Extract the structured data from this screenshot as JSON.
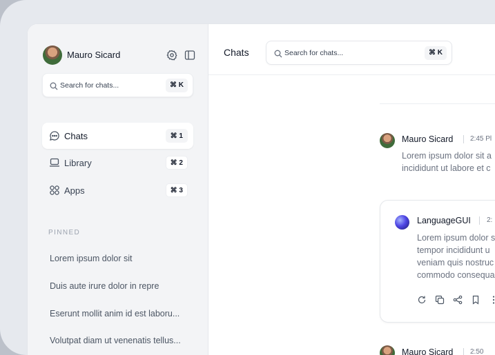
{
  "user": {
    "name": "Mauro Sicard"
  },
  "sidebar": {
    "search": {
      "placeholder": "Search for chats...",
      "shortcut": "⌘ K"
    },
    "nav": [
      {
        "label": "Chats",
        "shortcut": "⌘ 1",
        "icon": "chat-bubble-icon",
        "active": true
      },
      {
        "label": "Library",
        "shortcut": "⌘ 2",
        "icon": "laptop-icon",
        "active": false
      },
      {
        "label": "Apps",
        "shortcut": "⌘ 3",
        "icon": "apps-grid-icon",
        "active": false
      }
    ],
    "pinned_heading": "PINNED",
    "pinned": [
      "Lorem ipsum dolor sit",
      "Duis aute irure dolor in repre",
      "Eserunt mollit anim id est laboru...",
      "Volutpat diam ut venenatis tellus..."
    ]
  },
  "header": {
    "title": "Chats",
    "search": {
      "placeholder": "Search for chats...",
      "shortcut": "⌘ K"
    }
  },
  "messages": [
    {
      "author": "Mauro Sicard",
      "time": "2:45 Pl",
      "lines": [
        "Lorem ipsum dolor sit a",
        "incididunt ut labore et c"
      ]
    },
    {
      "author": "LanguageGUI",
      "time": "2:",
      "lines": [
        "Lorem ipsum dolor s",
        "tempor incididunt u",
        "veniam quis nostruc",
        "commodo consequa"
      ]
    },
    {
      "author": "Mauro Sicard",
      "time": "2:50"
    }
  ],
  "colors": {
    "accent": "#4f46e5",
    "sidebar_bg": "#f3f4f6",
    "background": "#bcc1ca"
  }
}
